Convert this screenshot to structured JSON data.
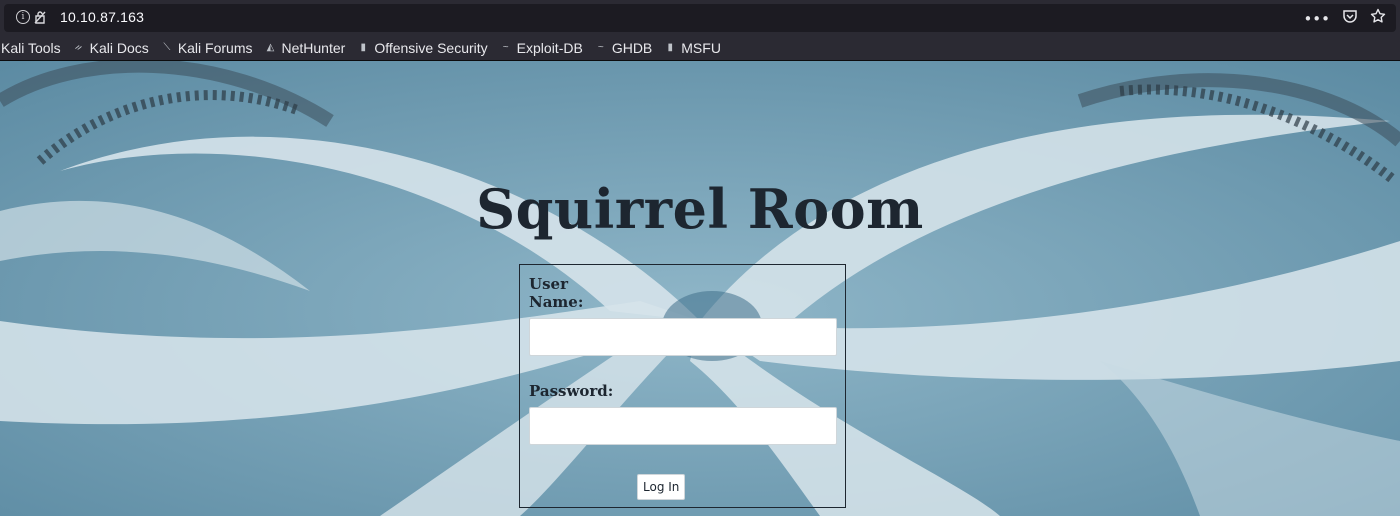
{
  "browser": {
    "url": "10.10.87.163",
    "icons": [
      "info-icon",
      "insecure-connection-icon",
      "more-actions-icon",
      "pocket-icon",
      "bookmark-star-icon"
    ],
    "bookmarks": [
      {
        "label": "Kali Tools",
        "icon": "none"
      },
      {
        "label": "Kali Docs",
        "icon": "kali-docs-icon"
      },
      {
        "label": "Kali Forums",
        "icon": "kali-forums-icon"
      },
      {
        "label": "NetHunter",
        "icon": "nethunter-icon"
      },
      {
        "label": "Offensive Security",
        "icon": "offsec-icon"
      },
      {
        "label": "Exploit-DB",
        "icon": "exploitdb-icon"
      },
      {
        "label": "GHDB",
        "icon": "ghdb-icon"
      },
      {
        "label": "MSFU",
        "icon": "msfu-icon"
      }
    ]
  },
  "page": {
    "title": "Squirrel Room",
    "login": {
      "username_label": "User Name:",
      "password_label": "Password:",
      "username_value": "",
      "password_value": "",
      "submit_label": "Log In"
    }
  },
  "colors": {
    "chrome_bg": "#2b2a33",
    "url_field_bg": "#1c1b22",
    "page_bg": "#6d9bb2",
    "swirl_light": "#d6e4ea",
    "title_text": "#1d2630"
  }
}
